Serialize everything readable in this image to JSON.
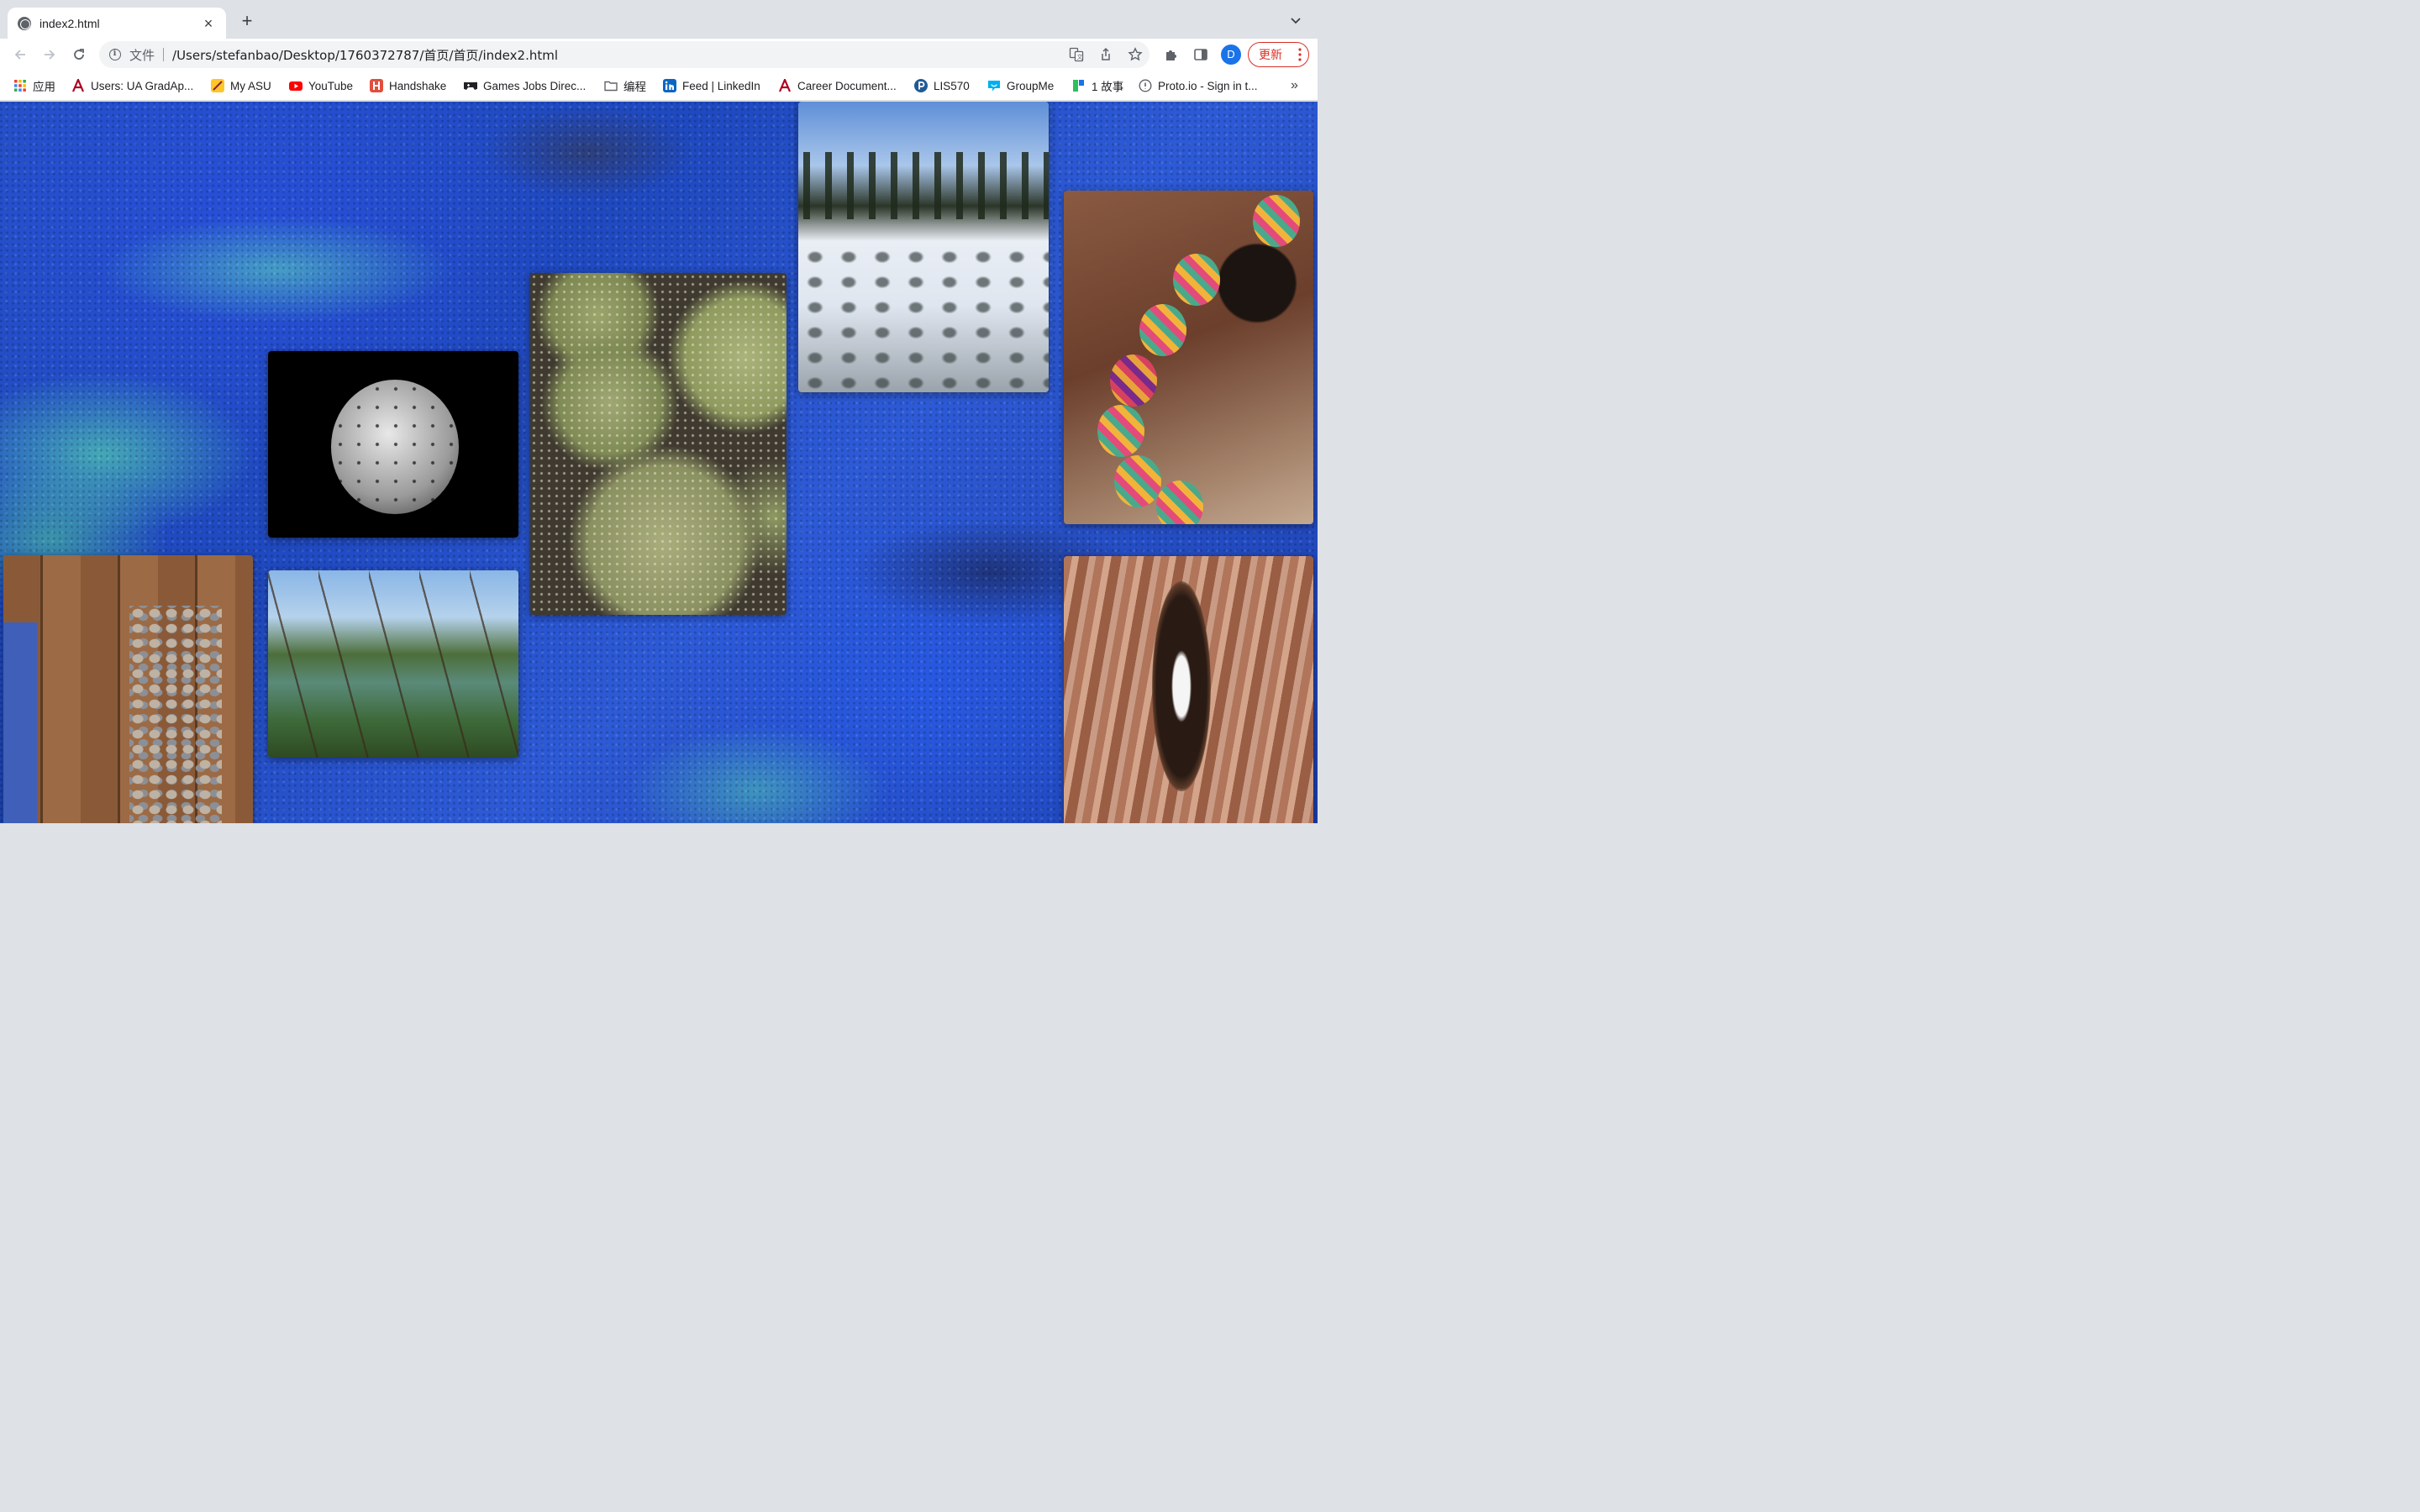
{
  "browser": {
    "tab": {
      "title": "index2.html",
      "favicon": "globe-icon"
    },
    "toolbar": {
      "security_chip": "文件",
      "url": "/Users/stefanbao/Desktop/1760372787/首页/首页/index2.html",
      "profile_initial": "D",
      "update_label": "更新"
    },
    "bookmarks": [
      {
        "label": "应用",
        "icon": "apps-grid-icon",
        "color": "#ea4335"
      },
      {
        "label": "Users: UA GradAp...",
        "icon": "ua-logo-icon",
        "color": "#ab0520"
      },
      {
        "label": "My ASU",
        "icon": "asu-icon",
        "color": "#ffc627"
      },
      {
        "label": "YouTube",
        "icon": "youtube-icon",
        "color": "#ff0000"
      },
      {
        "label": "Handshake",
        "icon": "handshake-icon",
        "color": "#e24e3d"
      },
      {
        "label": "Games Jobs Direc...",
        "icon": "gamepad-icon",
        "color": "#202124"
      },
      {
        "label": "编程",
        "icon": "folder-icon",
        "color": "#5f6368"
      },
      {
        "label": "Feed | LinkedIn",
        "icon": "linkedin-icon",
        "color": "#0a66c2"
      },
      {
        "label": "Career Document...",
        "icon": "ua-logo-icon",
        "color": "#ab0520"
      },
      {
        "label": "LIS570",
        "icon": "pressbooks-icon",
        "color": "#1f5a96"
      },
      {
        "label": "GroupMe",
        "icon": "groupme-icon",
        "color": "#00aff0"
      },
      {
        "label": "1 故事",
        "icon": "story-icon",
        "color": "#2dbf5b"
      },
      {
        "label": "Proto.io - Sign in t...",
        "icon": "proto-icon",
        "color": "#5f6368"
      }
    ]
  },
  "page": {
    "background": "blue-painted-rock-wall",
    "photos": [
      {
        "name": "photo-bw-cactus-pad"
      },
      {
        "name": "photo-barrel-cacti"
      },
      {
        "name": "photo-snowy-forest"
      },
      {
        "name": "photo-woven-ornaments"
      },
      {
        "name": "photo-feet-and-stones"
      },
      {
        "name": "photo-coastal-trees"
      },
      {
        "name": "photo-tree-bark"
      }
    ]
  }
}
